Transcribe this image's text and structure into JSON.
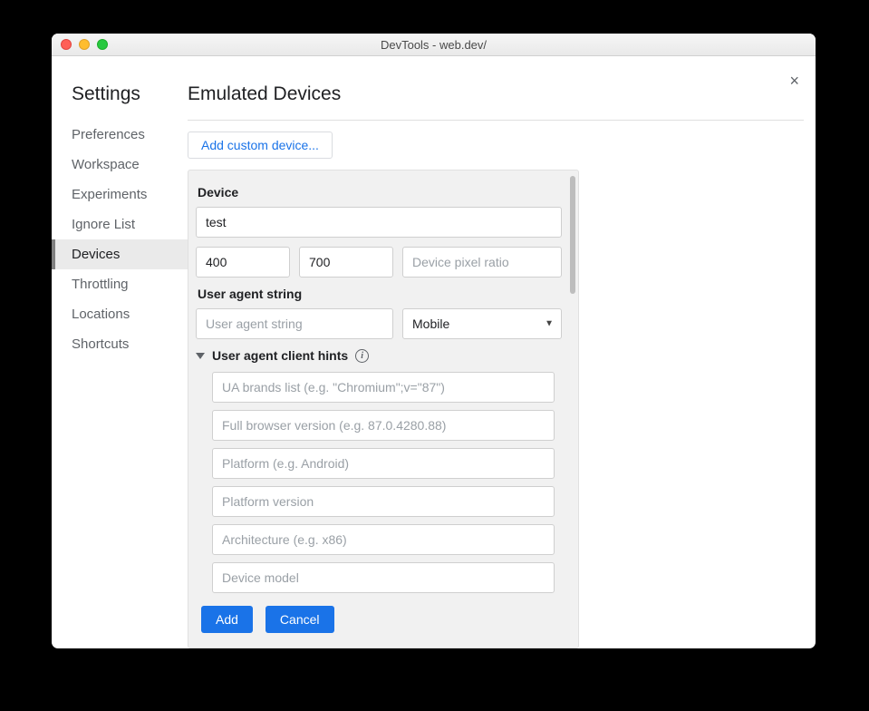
{
  "window": {
    "title": "DevTools - web.dev/"
  },
  "close_label": "×",
  "sidebar": {
    "title": "Settings",
    "items": [
      {
        "label": "Preferences"
      },
      {
        "label": "Workspace"
      },
      {
        "label": "Experiments"
      },
      {
        "label": "Ignore List"
      },
      {
        "label": "Devices",
        "active": true
      },
      {
        "label": "Throttling"
      },
      {
        "label": "Locations"
      },
      {
        "label": "Shortcuts"
      }
    ]
  },
  "main": {
    "heading": "Emulated Devices",
    "add_custom_label": "Add custom device..."
  },
  "device_form": {
    "section_label": "Device",
    "name_value": "test",
    "width_value": "400",
    "height_value": "700",
    "dpr_placeholder": "Device pixel ratio",
    "ua_section_label": "User agent string",
    "ua_placeholder": "User agent string",
    "ua_type_value": "Mobile",
    "hints": {
      "label": "User agent client hints",
      "info_char": "i",
      "placeholders": {
        "brands": "UA brands list (e.g. \"Chromium\";v=\"87\")",
        "full_version": "Full browser version (e.g. 87.0.4280.88)",
        "platform": "Platform (e.g. Android)",
        "platform_version": "Platform version",
        "arch": "Architecture (e.g. x86)",
        "model": "Device model"
      }
    },
    "buttons": {
      "add": "Add",
      "cancel": "Cancel"
    }
  }
}
